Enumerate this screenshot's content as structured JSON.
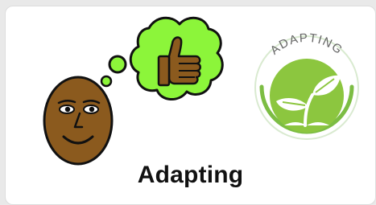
{
  "card": {
    "caption": "Adapting"
  },
  "badge": {
    "arc_text": "ADAPTING",
    "icon": "sprout-icon",
    "ring_color": "#7cbd43",
    "fill_color": "#8cc63f"
  },
  "thinking_symbol": {
    "icon": "thinking-face-thumbs-up-icon",
    "face_color": "#8b5a1e",
    "thought_color": "#8cf53a"
  }
}
